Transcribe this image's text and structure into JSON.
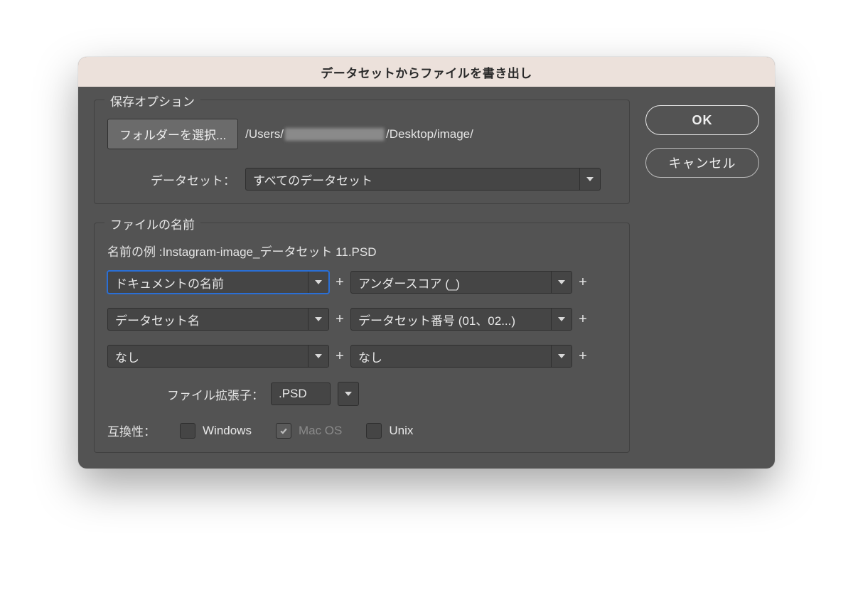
{
  "dialog": {
    "title": "データセットからファイルを書き出し"
  },
  "save_options": {
    "group_title": "保存オプション",
    "select_folder_btn": "フォルダーを選択...",
    "path_prefix": "/Users/",
    "path_suffix": "/Desktop/image/",
    "dataset_label": "データセット：",
    "dataset_value": "すべてのデータセット"
  },
  "file_naming": {
    "group_title": "ファイルの名前",
    "example_label": "名前の例 :",
    "example_value": "Instagram-image_データセット 11.PSD",
    "parts": [
      {
        "left": "ドキュメントの名前",
        "right": "アンダースコア (_)"
      },
      {
        "left": "データセット名",
        "right": "データセット番号 (01、02...)"
      },
      {
        "left": "なし",
        "right": "なし"
      }
    ],
    "extension_label": "ファイル拡張子：",
    "extension_value": ".PSD",
    "compat_label": "互換性：",
    "compat": {
      "windows": {
        "label": "Windows",
        "checked": false,
        "enabled": true
      },
      "macos": {
        "label": "Mac OS",
        "checked": true,
        "enabled": false
      },
      "unix": {
        "label": "Unix",
        "checked": false,
        "enabled": true
      }
    }
  },
  "actions": {
    "ok": "OK",
    "cancel": "キャンセル"
  },
  "glyphs": {
    "plus": "+"
  }
}
